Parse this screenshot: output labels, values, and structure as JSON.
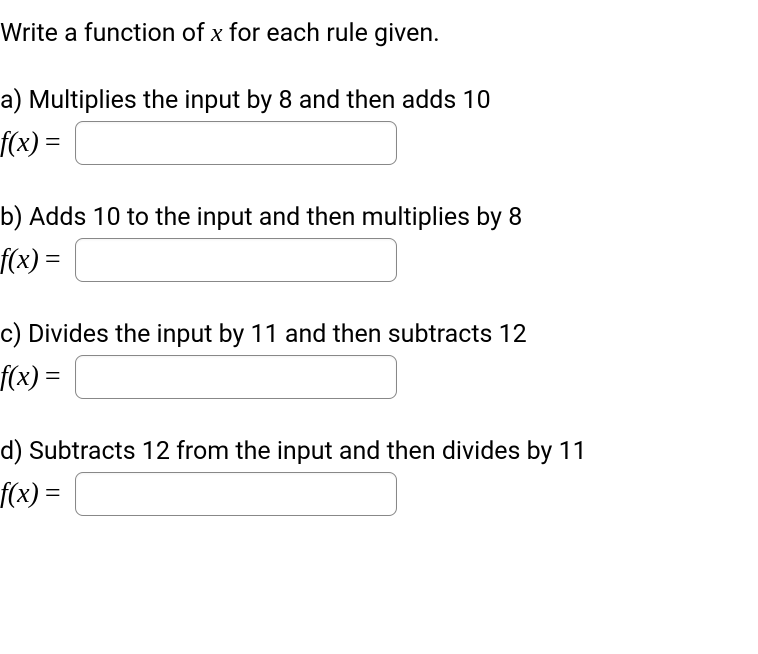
{
  "instruction": {
    "prefix": "Write a function of ",
    "var": "x",
    "suffix": " for each rule given."
  },
  "problems": [
    {
      "label": "a)",
      "text": "Multiplies the input by 8 and then adds 10",
      "lhs": "f(x)",
      "equals": "=",
      "value": ""
    },
    {
      "label": "b)",
      "text": "Adds 10 to the input and then multiplies by 8",
      "lhs": "f(x)",
      "equals": "=",
      "value": ""
    },
    {
      "label": "c)",
      "text": "Divides the input by 11 and then subtracts 12",
      "lhs": "f(x)",
      "equals": "=",
      "value": ""
    },
    {
      "label": "d)",
      "text": "Subtracts 12 from the input and then divides by 11",
      "lhs": "f(x)",
      "equals": "=",
      "value": ""
    }
  ]
}
